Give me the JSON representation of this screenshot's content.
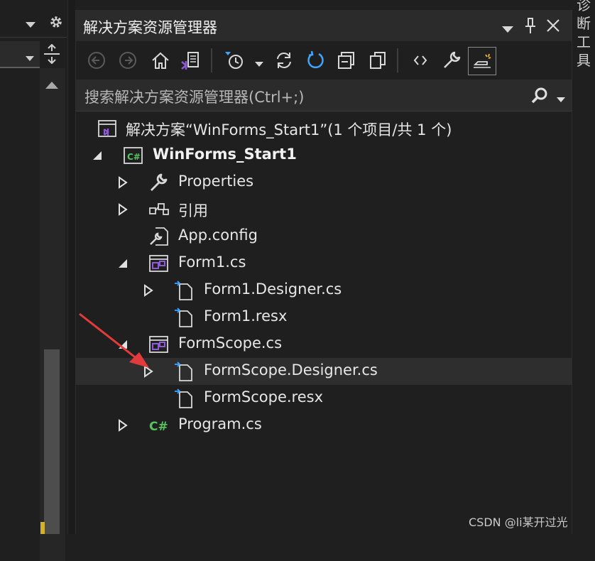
{
  "solution_explorer": {
    "title": "解决方案资源管理器",
    "search_placeholder": "搜索解决方案资源管理器(Ctrl+;)",
    "tree": [
      {
        "label": "解决方案“WinForms_Start1”(1 个项目/共 1 个)",
        "icon": "solution-icon",
        "expander": "none",
        "bold": false
      },
      {
        "label": "WinForms_Start1",
        "icon": "csharp-project-icon",
        "expander": "expanded",
        "bold": true
      },
      {
        "label": "Properties",
        "icon": "wrench-icon",
        "expander": "collapsed",
        "bold": false
      },
      {
        "label": "引用",
        "icon": "references-icon",
        "expander": "collapsed",
        "bold": false
      },
      {
        "label": "App.config",
        "icon": "config-icon",
        "expander": "none",
        "bold": false
      },
      {
        "label": "Form1.cs",
        "icon": "form-icon",
        "expander": "expanded",
        "bold": false
      },
      {
        "label": "Form1.Designer.cs",
        "icon": "file-icon",
        "expander": "collapsed",
        "bold": false
      },
      {
        "label": "Form1.resx",
        "icon": "file-icon",
        "expander": "none",
        "bold": false
      },
      {
        "label": "FormScope.cs",
        "icon": "form-icon",
        "expander": "expanded",
        "bold": false
      },
      {
        "label": "FormScope.Designer.cs",
        "icon": "file-icon",
        "expander": "collapsed",
        "bold": false,
        "selected": true
      },
      {
        "label": "FormScope.resx",
        "icon": "file-icon",
        "expander": "none",
        "bold": false
      },
      {
        "label": "Program.cs",
        "icon": "csharp-file-icon",
        "expander": "collapsed",
        "bold": false
      }
    ]
  },
  "right_tab": {
    "label": "诊断工具"
  },
  "watermark": "CSDN @li某开过光",
  "colors": {
    "background": "#1f1f1f",
    "title_bar": "#2b2b2b",
    "accent_blue": "#3ea6ff",
    "vs_purple": "#8e5ad6",
    "csharp_green": "#57c35f",
    "annotation_red": "#e23b3b"
  }
}
